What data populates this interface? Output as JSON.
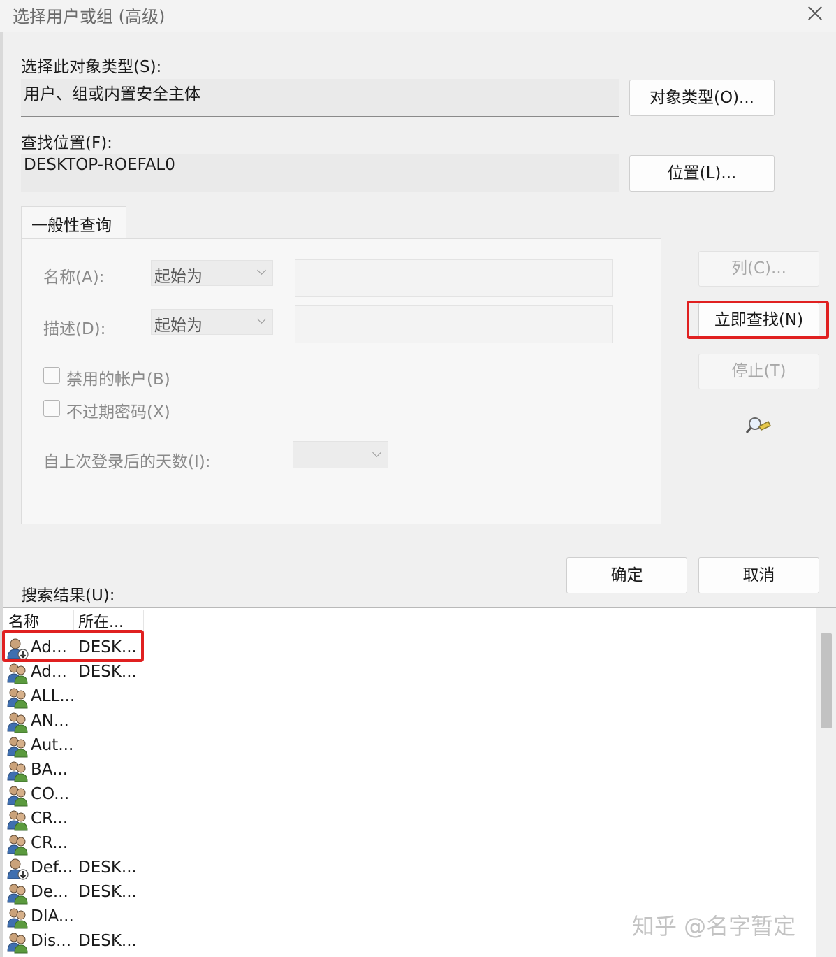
{
  "window": {
    "title": "选择用户或组 (高级)"
  },
  "object_type": {
    "label": "选择此对象类型(S):",
    "value": "用户、组或内置安全主体",
    "button": "对象类型(O)..."
  },
  "location": {
    "label": "查找位置(F):",
    "value": "DESKTOP-ROEFAL0",
    "button": "位置(L)..."
  },
  "query": {
    "tab": "一般性查询",
    "name_label": "名称(A):",
    "name_mode": "起始为",
    "desc_label": "描述(D):",
    "desc_mode": "起始为",
    "disabled_accounts": "禁用的帐户(B)",
    "non_expiring_pw": "不过期密码(X)",
    "days_since_logon": "自上次登录后的天数(I):"
  },
  "side_buttons": {
    "columns": "列(C)...",
    "find_now": "立即查找(N)",
    "stop": "停止(T)"
  },
  "dialog_buttons": {
    "ok": "确定",
    "cancel": "取消"
  },
  "results": {
    "label": "搜索结果(U):",
    "columns": [
      "名称",
      "所在..."
    ],
    "rows": [
      {
        "name": "Ad...",
        "location": "DESK...",
        "icon": "user-icon"
      },
      {
        "name": "Ad...",
        "location": "DESK...",
        "icon": "group-icon"
      },
      {
        "name": "ALL...",
        "location": "",
        "icon": "group-icon"
      },
      {
        "name": "AN...",
        "location": "",
        "icon": "group-icon"
      },
      {
        "name": "Aut...",
        "location": "",
        "icon": "group-icon"
      },
      {
        "name": "BA...",
        "location": "",
        "icon": "group-icon"
      },
      {
        "name": "CO...",
        "location": "",
        "icon": "group-icon"
      },
      {
        "name": "CR...",
        "location": "",
        "icon": "group-icon"
      },
      {
        "name": "CR...",
        "location": "",
        "icon": "group-icon"
      },
      {
        "name": "Def...",
        "location": "DESK...",
        "icon": "user-icon"
      },
      {
        "name": "De...",
        "location": "DESK...",
        "icon": "group-icon"
      },
      {
        "name": "DIA...",
        "location": "",
        "icon": "group-icon"
      },
      {
        "name": "Dis...",
        "location": "DESK...",
        "icon": "group-icon"
      }
    ]
  },
  "watermark": "知乎 @名字暂定",
  "colors": {
    "highlight": "#e02020",
    "window_bg": "#f0f0f0",
    "disabled_text": "#a8a8a8"
  }
}
